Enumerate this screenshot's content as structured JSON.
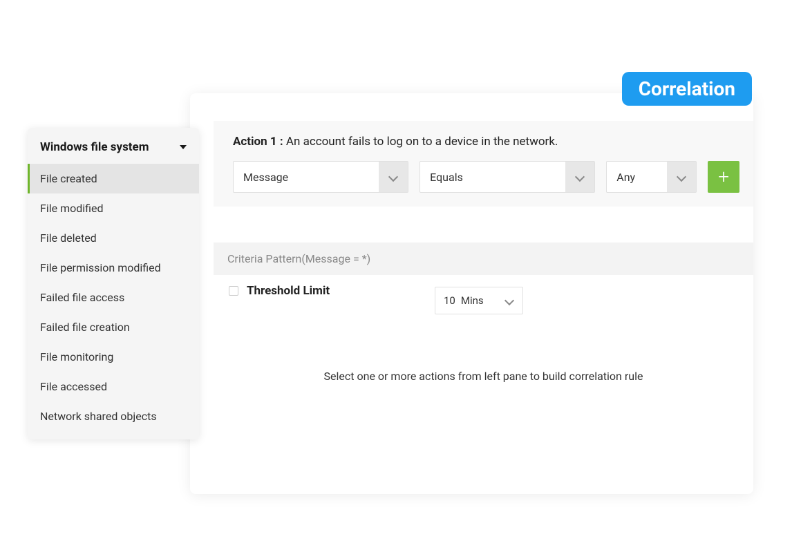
{
  "badge": {
    "label": "Correlation"
  },
  "sidebar": {
    "title": "Windows file system",
    "items": [
      {
        "label": "File created",
        "active": true
      },
      {
        "label": "File modified",
        "active": false
      },
      {
        "label": "File deleted",
        "active": false
      },
      {
        "label": "File permission modified",
        "active": false
      },
      {
        "label": "Failed file access",
        "active": false
      },
      {
        "label": "Failed file creation",
        "active": false
      },
      {
        "label": "File monitoring",
        "active": false
      },
      {
        "label": "File accessed",
        "active": false
      },
      {
        "label": "Network shared objects",
        "active": false
      }
    ]
  },
  "action": {
    "title_prefix": "Action 1 :",
    "title_text": " An account fails to log on to a device in the network.",
    "field_select": "Message",
    "operator_select": "Equals",
    "value_select": "Any"
  },
  "criteria": {
    "label": "Criteria Pattern(Message = *)"
  },
  "threshold": {
    "label": "Threshold Limit",
    "value": "10",
    "unit": "Mins"
  },
  "hint": "Select one or more actions from left pane to build correlation rule"
}
